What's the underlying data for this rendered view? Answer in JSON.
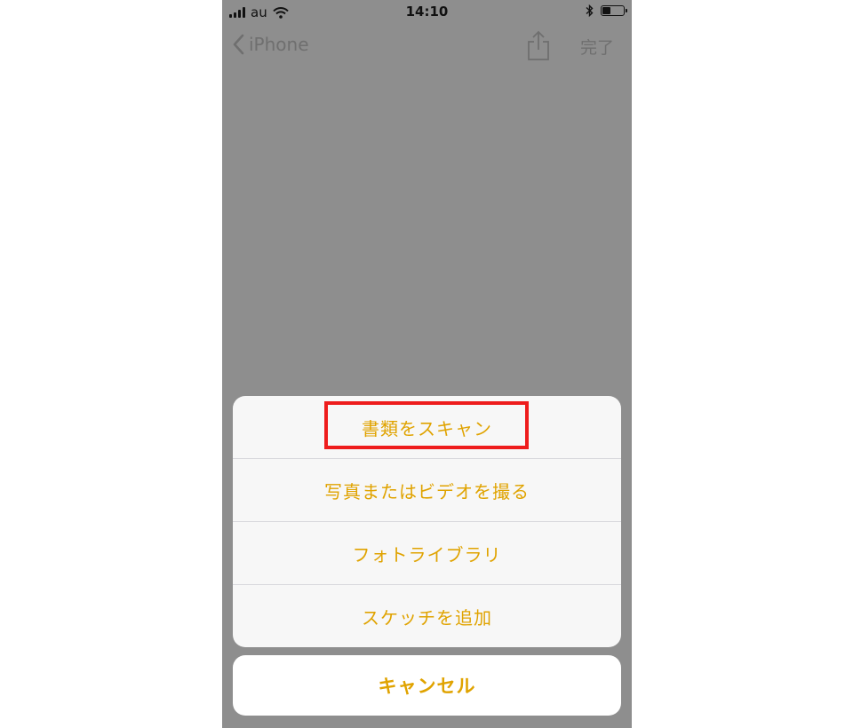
{
  "status_bar": {
    "carrier": "au",
    "time": "14:10",
    "icons": [
      "signal-icon",
      "wifi-icon",
      "bluetooth-icon",
      "battery-icon"
    ]
  },
  "nav_bar": {
    "back_label": "iPhone",
    "done_label": "完了",
    "icons": [
      "chevron-left-icon",
      "share-icon"
    ]
  },
  "action_sheet": {
    "items": [
      {
        "label": "書類をスキャン",
        "highlighted": true
      },
      {
        "label": "写真またはビデオを撮る"
      },
      {
        "label": "フォトライブラリ"
      },
      {
        "label": "スケッチを追加"
      }
    ],
    "cancel_label": "キャンセル"
  },
  "colors": {
    "accent": "#e0a300",
    "highlight_box": "#ee1c1c",
    "dim_background": "#8e8e8e"
  }
}
